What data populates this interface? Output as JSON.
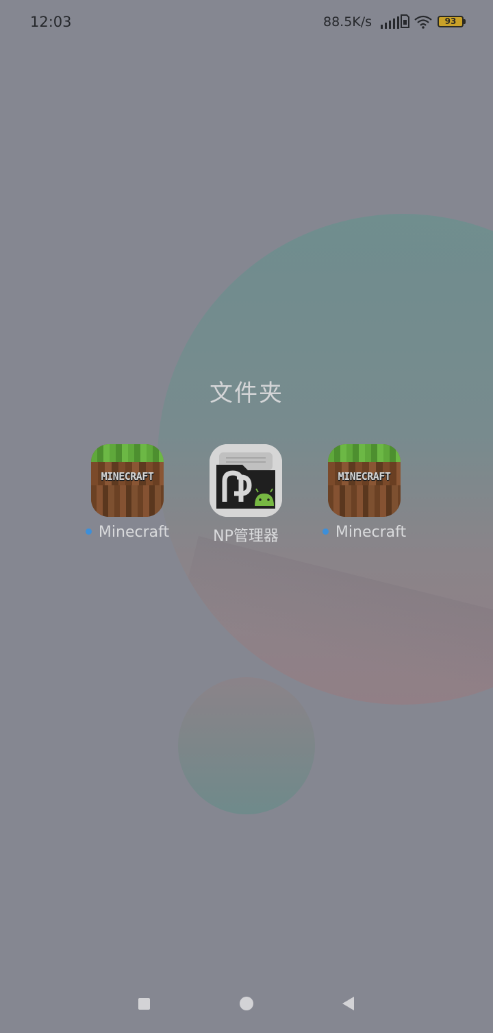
{
  "status_bar": {
    "time": "12:03",
    "net_speed": "88.5K/s",
    "battery_level": "93",
    "icons": [
      "signal-icon",
      "sim-card-icon",
      "wifi-icon",
      "battery-icon"
    ],
    "battery_color": "#c9a128"
  },
  "folder": {
    "title": "文件夹",
    "apps": [
      {
        "label": "Minecraft",
        "icon_text": "MINECRAFT",
        "icon": "minecraft-icon",
        "new_badge": true
      },
      {
        "label": "NP管理器",
        "icon": "np-manager-icon",
        "new_badge": false
      },
      {
        "label": "Minecraft",
        "icon_text": "MINECRAFT",
        "icon": "minecraft-icon",
        "new_badge": true
      }
    ]
  },
  "nav_bar": {
    "buttons": [
      "recent-apps-icon",
      "home-icon",
      "back-icon"
    ]
  },
  "colors": {
    "background": "#858791",
    "new_badge": "#3d8fd9"
  }
}
